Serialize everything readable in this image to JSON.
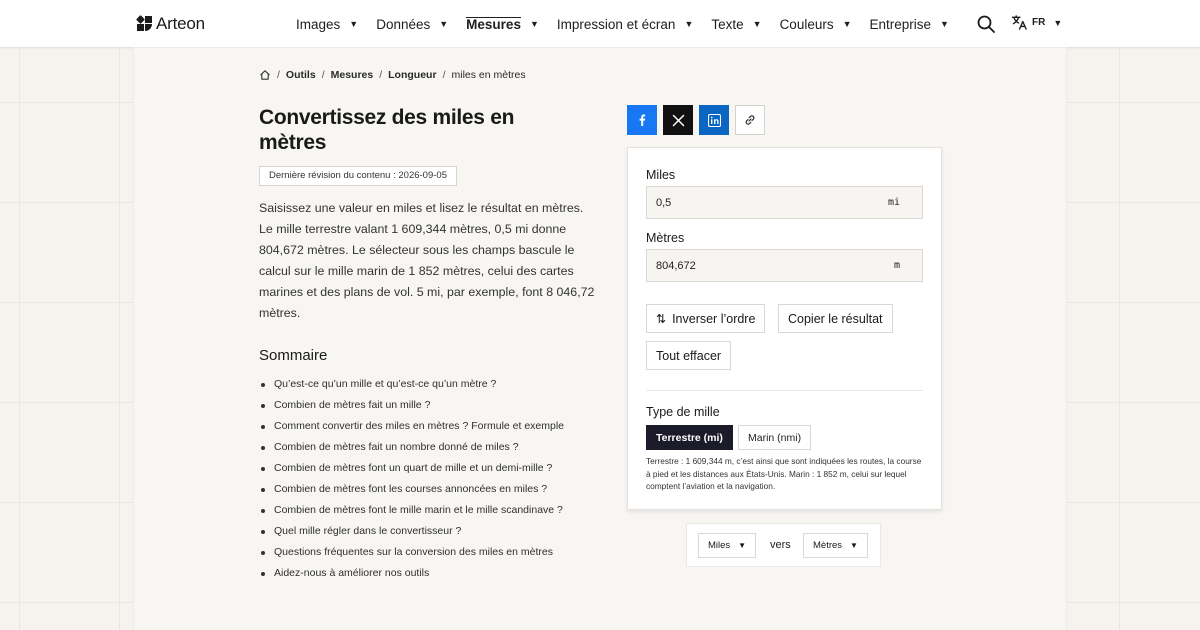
{
  "brand": {
    "name": "Arteon"
  },
  "nav": [
    {
      "label": "Images",
      "active": false
    },
    {
      "label": "Données",
      "active": false
    },
    {
      "label": "Mesures",
      "active": true
    },
    {
      "label": "Impression et écran",
      "active": false
    },
    {
      "label": "Texte",
      "active": false
    },
    {
      "label": "Couleurs",
      "active": false
    },
    {
      "label": "Entreprise",
      "active": false
    }
  ],
  "header": {
    "lang": "FR",
    "caret": "▼"
  },
  "breadcrumb": {
    "sep": "/",
    "items": [
      "Outils",
      "Mesures",
      "Longueur",
      "miles en mètres"
    ]
  },
  "page": {
    "title": "Convertissez des miles en mètres",
    "revision": "Dernière révision du contenu : 2026-09-05",
    "intro": "Saisissez une valeur en miles et lisez le résultat en mètres. Le mille terrestre valant 1 609,344 mètres, 0,5 mi donne 804,672 mètres. Le sélecteur sous les champs bascule le calcul sur le mille marin de 1 852 mètres, celui des cartes marines et des plans de vol. 5 mi, par exemple, font 8 046,72 mètres."
  },
  "summary": {
    "title": "Sommaire",
    "items": [
      "Qu’est-ce qu’un mille et qu’est-ce qu’un mètre ?",
      "Combien de mètres fait un mille ?",
      "Comment convertir des miles en mètres ? Formule et exemple",
      "Combien de mètres fait un nombre donné de miles ?",
      "Combien de mètres font un quart de mille et un demi-mille ?",
      "Combien de mètres font les courses annoncées en miles ?",
      "Combien de mètres font le mille marin et le mille scandinave ?",
      "Quel mille régler dans le convertisseur ?",
      "Questions fréquentes sur la conversion des miles en mètres",
      "Aidez-nous à améliorer nos outils"
    ]
  },
  "converter": {
    "from_label": "Miles",
    "from_value": "0,5",
    "from_unit": "mi",
    "to_label": "Mètres",
    "to_value": "804,672",
    "to_unit": "m",
    "swap_label": "Inverser l’ordre",
    "copy_label": "Copier le résultat",
    "clear_label": "Tout effacer",
    "type_label": "Type de mille",
    "type_options": [
      "Terrestre (mi)",
      "Marin (nmi)"
    ],
    "type_selected": "Terrestre (mi)",
    "note": "Terrestre : 1 609,344 m, c’est ainsi que sont indiquées les routes, la course à pied et les distances aux États-Unis. Marin : 1 852 m, celui sur lequel comptent l’aviation et la navigation."
  },
  "unit_bar": {
    "from": "Miles",
    "connector": "vers",
    "to": "Mètres"
  },
  "colors": {
    "facebook": "#1877f2",
    "x": "#111111",
    "linkedin": "#0a66c2",
    "selected": "#1c1b2a"
  }
}
